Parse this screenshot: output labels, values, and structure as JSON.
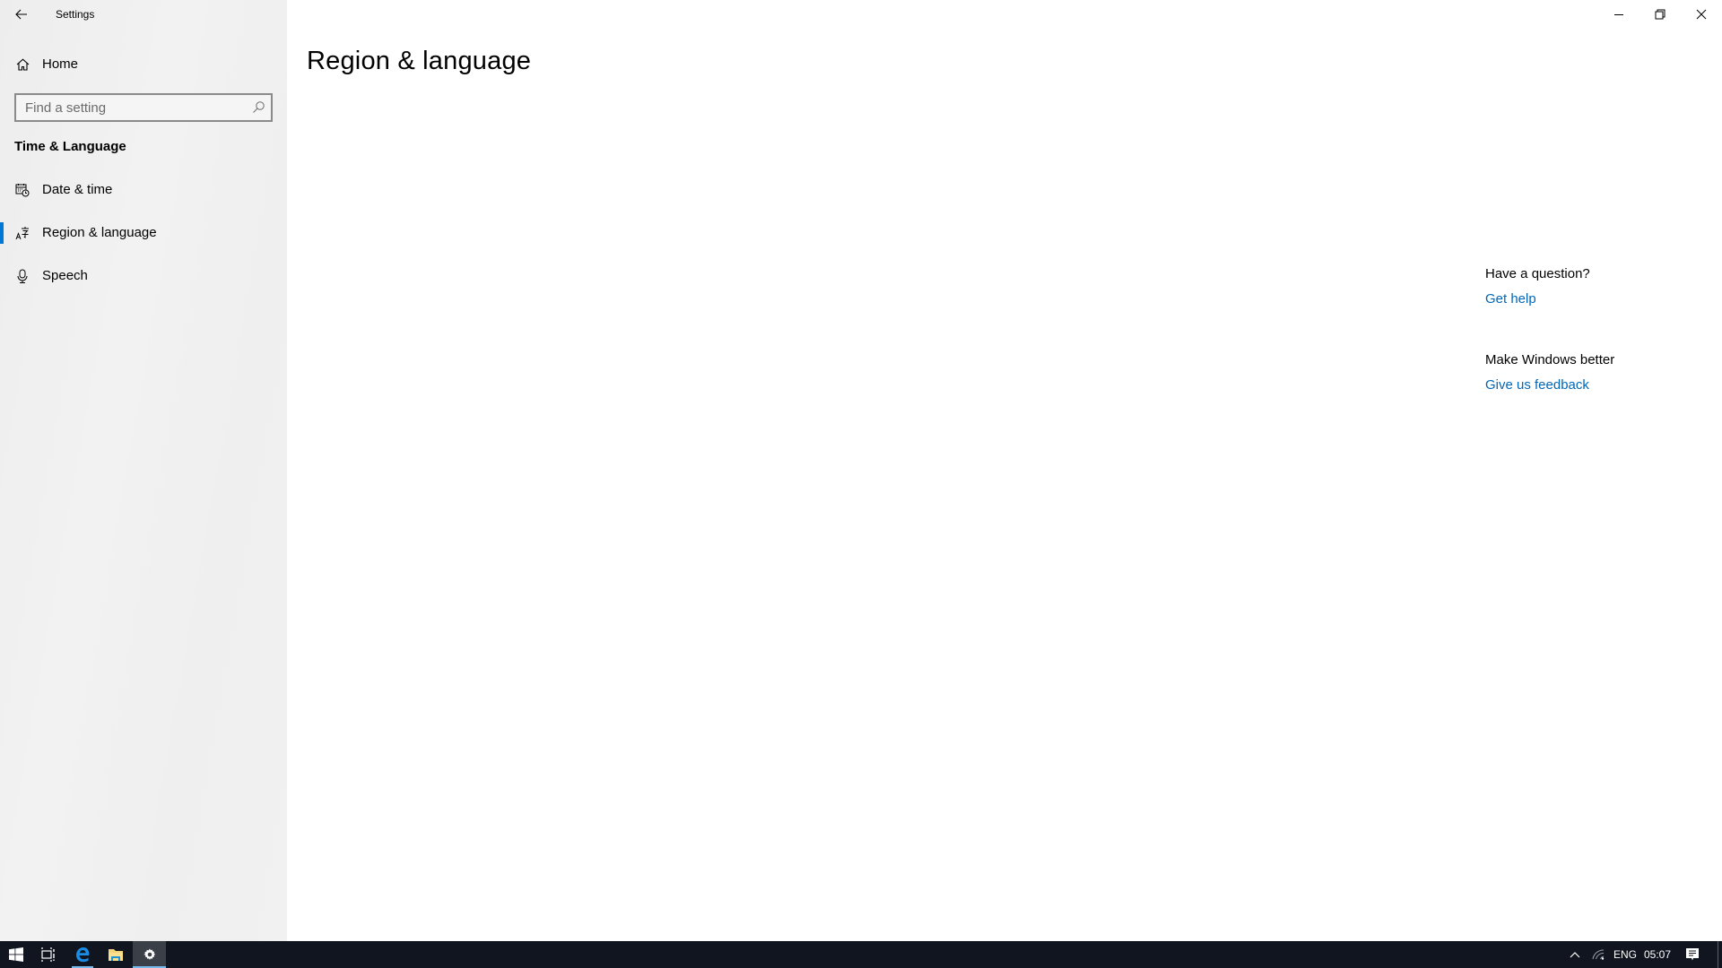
{
  "window": {
    "title": "Settings",
    "controls": {
      "minimize": "minimize",
      "restore": "restore",
      "close": "close"
    }
  },
  "sidebar": {
    "home_label": "Home",
    "search": {
      "placeholder": "Find a setting",
      "value": ""
    },
    "section_title": "Time & Language",
    "items": [
      {
        "label": "Date & time",
        "icon": "calendar-clock-icon",
        "selected": false
      },
      {
        "label": "Region & language",
        "icon": "language-icon",
        "selected": true
      },
      {
        "label": "Speech",
        "icon": "microphone-icon",
        "selected": false
      }
    ]
  },
  "main": {
    "page_title": "Region & language"
  },
  "help_panel": {
    "question_heading": "Have a question?",
    "get_help_link": "Get help",
    "feedback_heading": "Make Windows better",
    "feedback_link": "Give us feedback"
  },
  "taskbar": {
    "apps": [
      {
        "name": "Task View",
        "icon": "task-view-icon",
        "active": false
      },
      {
        "name": "Microsoft Edge",
        "icon": "edge-icon",
        "active": false,
        "running": true
      },
      {
        "name": "File Explorer",
        "icon": "folder-icon",
        "active": false
      },
      {
        "name": "Settings",
        "icon": "gear-icon",
        "active": true
      }
    ],
    "tray": {
      "language": "ENG",
      "time": "05:07"
    }
  },
  "colors": {
    "accent": "#0078d7",
    "link": "#0067b8",
    "taskbar": "#101520"
  }
}
